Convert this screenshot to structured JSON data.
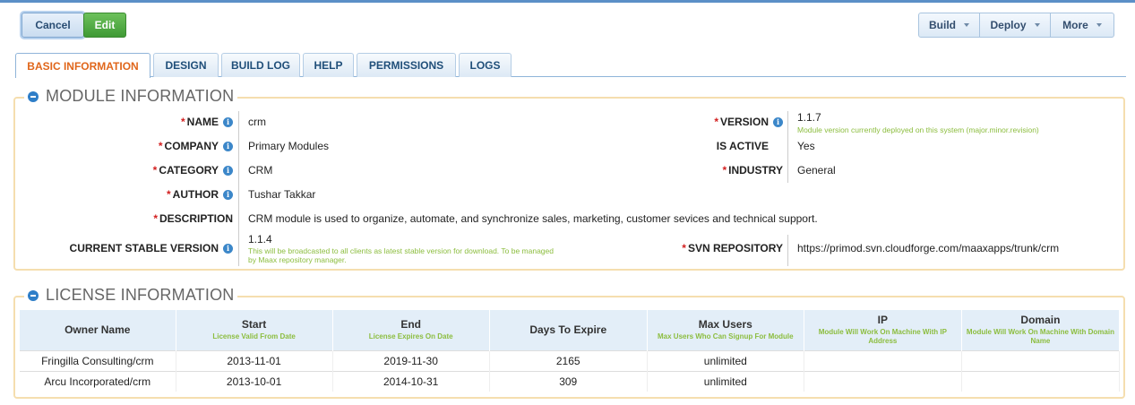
{
  "toolbar": {
    "cancel_label": "Cancel",
    "edit_label": "Edit",
    "build_label": "Build",
    "deploy_label": "Deploy",
    "more_label": "More"
  },
  "tabs": [
    {
      "label": "BASIC INFORMATION",
      "active": true
    },
    {
      "label": "DESIGN"
    },
    {
      "label": "BUILD LOG"
    },
    {
      "label": "HELP"
    },
    {
      "label": "PERMISSIONS"
    },
    {
      "label": "LOGS"
    }
  ],
  "module_info": {
    "title": "MODULE INFORMATION",
    "name_label": "NAME",
    "name_value": "crm",
    "company_label": "COMPANY",
    "company_value": "Primary Modules",
    "category_label": "CATEGORY",
    "category_value": "CRM",
    "author_label": "AUTHOR",
    "author_value": "Tushar Takkar",
    "description_label": "DESCRIPTION",
    "description_value": "CRM module is used to organize, automate, and synchronize sales, marketing, customer sevices and technical support.",
    "stable_label": "CURRENT STABLE VERSION",
    "stable_value": "1.1.4",
    "stable_hint": "This will be broadcasted to all clients as latest stable version for download. To be managed by Maax repository manager.",
    "version_label": "VERSION",
    "version_value": "1.1.7",
    "version_hint": "Module version currently deployed on this system (major.minor.revision)",
    "active_label": "IS ACTIVE",
    "active_value": "Yes",
    "industry_label": "INDUSTRY",
    "industry_value": "General",
    "svn_label": "SVN REPOSITORY",
    "svn_value": "https://primod.svn.cloudforge.com/maaxapps/trunk/crm",
    "required_mark": "*",
    "info_glyph": "i"
  },
  "license_info": {
    "title": "LICENSE INFORMATION",
    "columns": [
      {
        "label": "Owner Name",
        "sub": ""
      },
      {
        "label": "Start",
        "sub": "License Valid From Date"
      },
      {
        "label": "End",
        "sub": "License Expires On Date"
      },
      {
        "label": "Days To Expire",
        "sub": ""
      },
      {
        "label": "Max Users",
        "sub": "Max Users Who Can Signup For Module"
      },
      {
        "label": "IP",
        "sub": "Module Will Work On Machine With IP Address"
      },
      {
        "label": "Domain",
        "sub": "Module Will Work On Machine With Domain Name"
      }
    ],
    "rows": [
      [
        "Fringilla Consulting/crm",
        "2013-11-01",
        "2019-11-30",
        "2165",
        "unlimited",
        "",
        ""
      ],
      [
        "Arcu Incorporated/crm",
        "2013-10-01",
        "2014-10-31",
        "309",
        "unlimited",
        "",
        ""
      ]
    ]
  },
  "colors": {
    "accent": "#e0661b",
    "primary": "#1f4e79",
    "hint": "#8cbd3f",
    "required": "#d21f1f",
    "fieldset_border": "#f5deaf"
  }
}
